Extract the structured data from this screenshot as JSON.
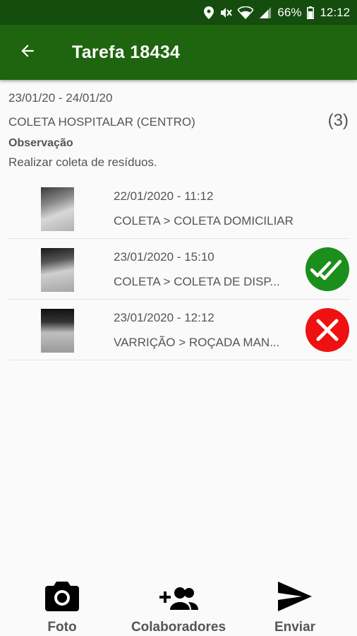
{
  "status_bar": {
    "battery": "66%",
    "time": "12:12",
    "icons": [
      "location-icon",
      "mute-icon",
      "wifi-icon",
      "signal-icon",
      "battery-icon"
    ]
  },
  "app_bar": {
    "title": "Tarefa 18434",
    "back_icon": "arrow-back-icon"
  },
  "task": {
    "dates": "23/01/20 - 24/01/20",
    "group": "COLETA HOSPITALAR (CENTRO)",
    "count": "(3)",
    "observation_label": "Observação",
    "observation_text": "Realizar coleta de resíduos."
  },
  "items": [
    {
      "datetime": "22/01/2020 - 11:12",
      "description": "COLETA > COLETA DOMICILIAR",
      "status": "none"
    },
    {
      "datetime": "23/01/2020 - 15:10",
      "description": "COLETA > COLETA DE DISP...",
      "status": "done"
    },
    {
      "datetime": "23/01/2020 - 12:12",
      "description": "VARRIÇÃO > ROÇADA MAN...",
      "status": "failed"
    }
  ],
  "colors": {
    "status_bar": "#144d0e",
    "app_bar": "#1f640f",
    "done": "#1b8f1b",
    "failed": "#ef1111"
  },
  "bottom_actions": {
    "photo": "Foto",
    "collaborators": "Colaboradores",
    "send": "Enviar"
  }
}
